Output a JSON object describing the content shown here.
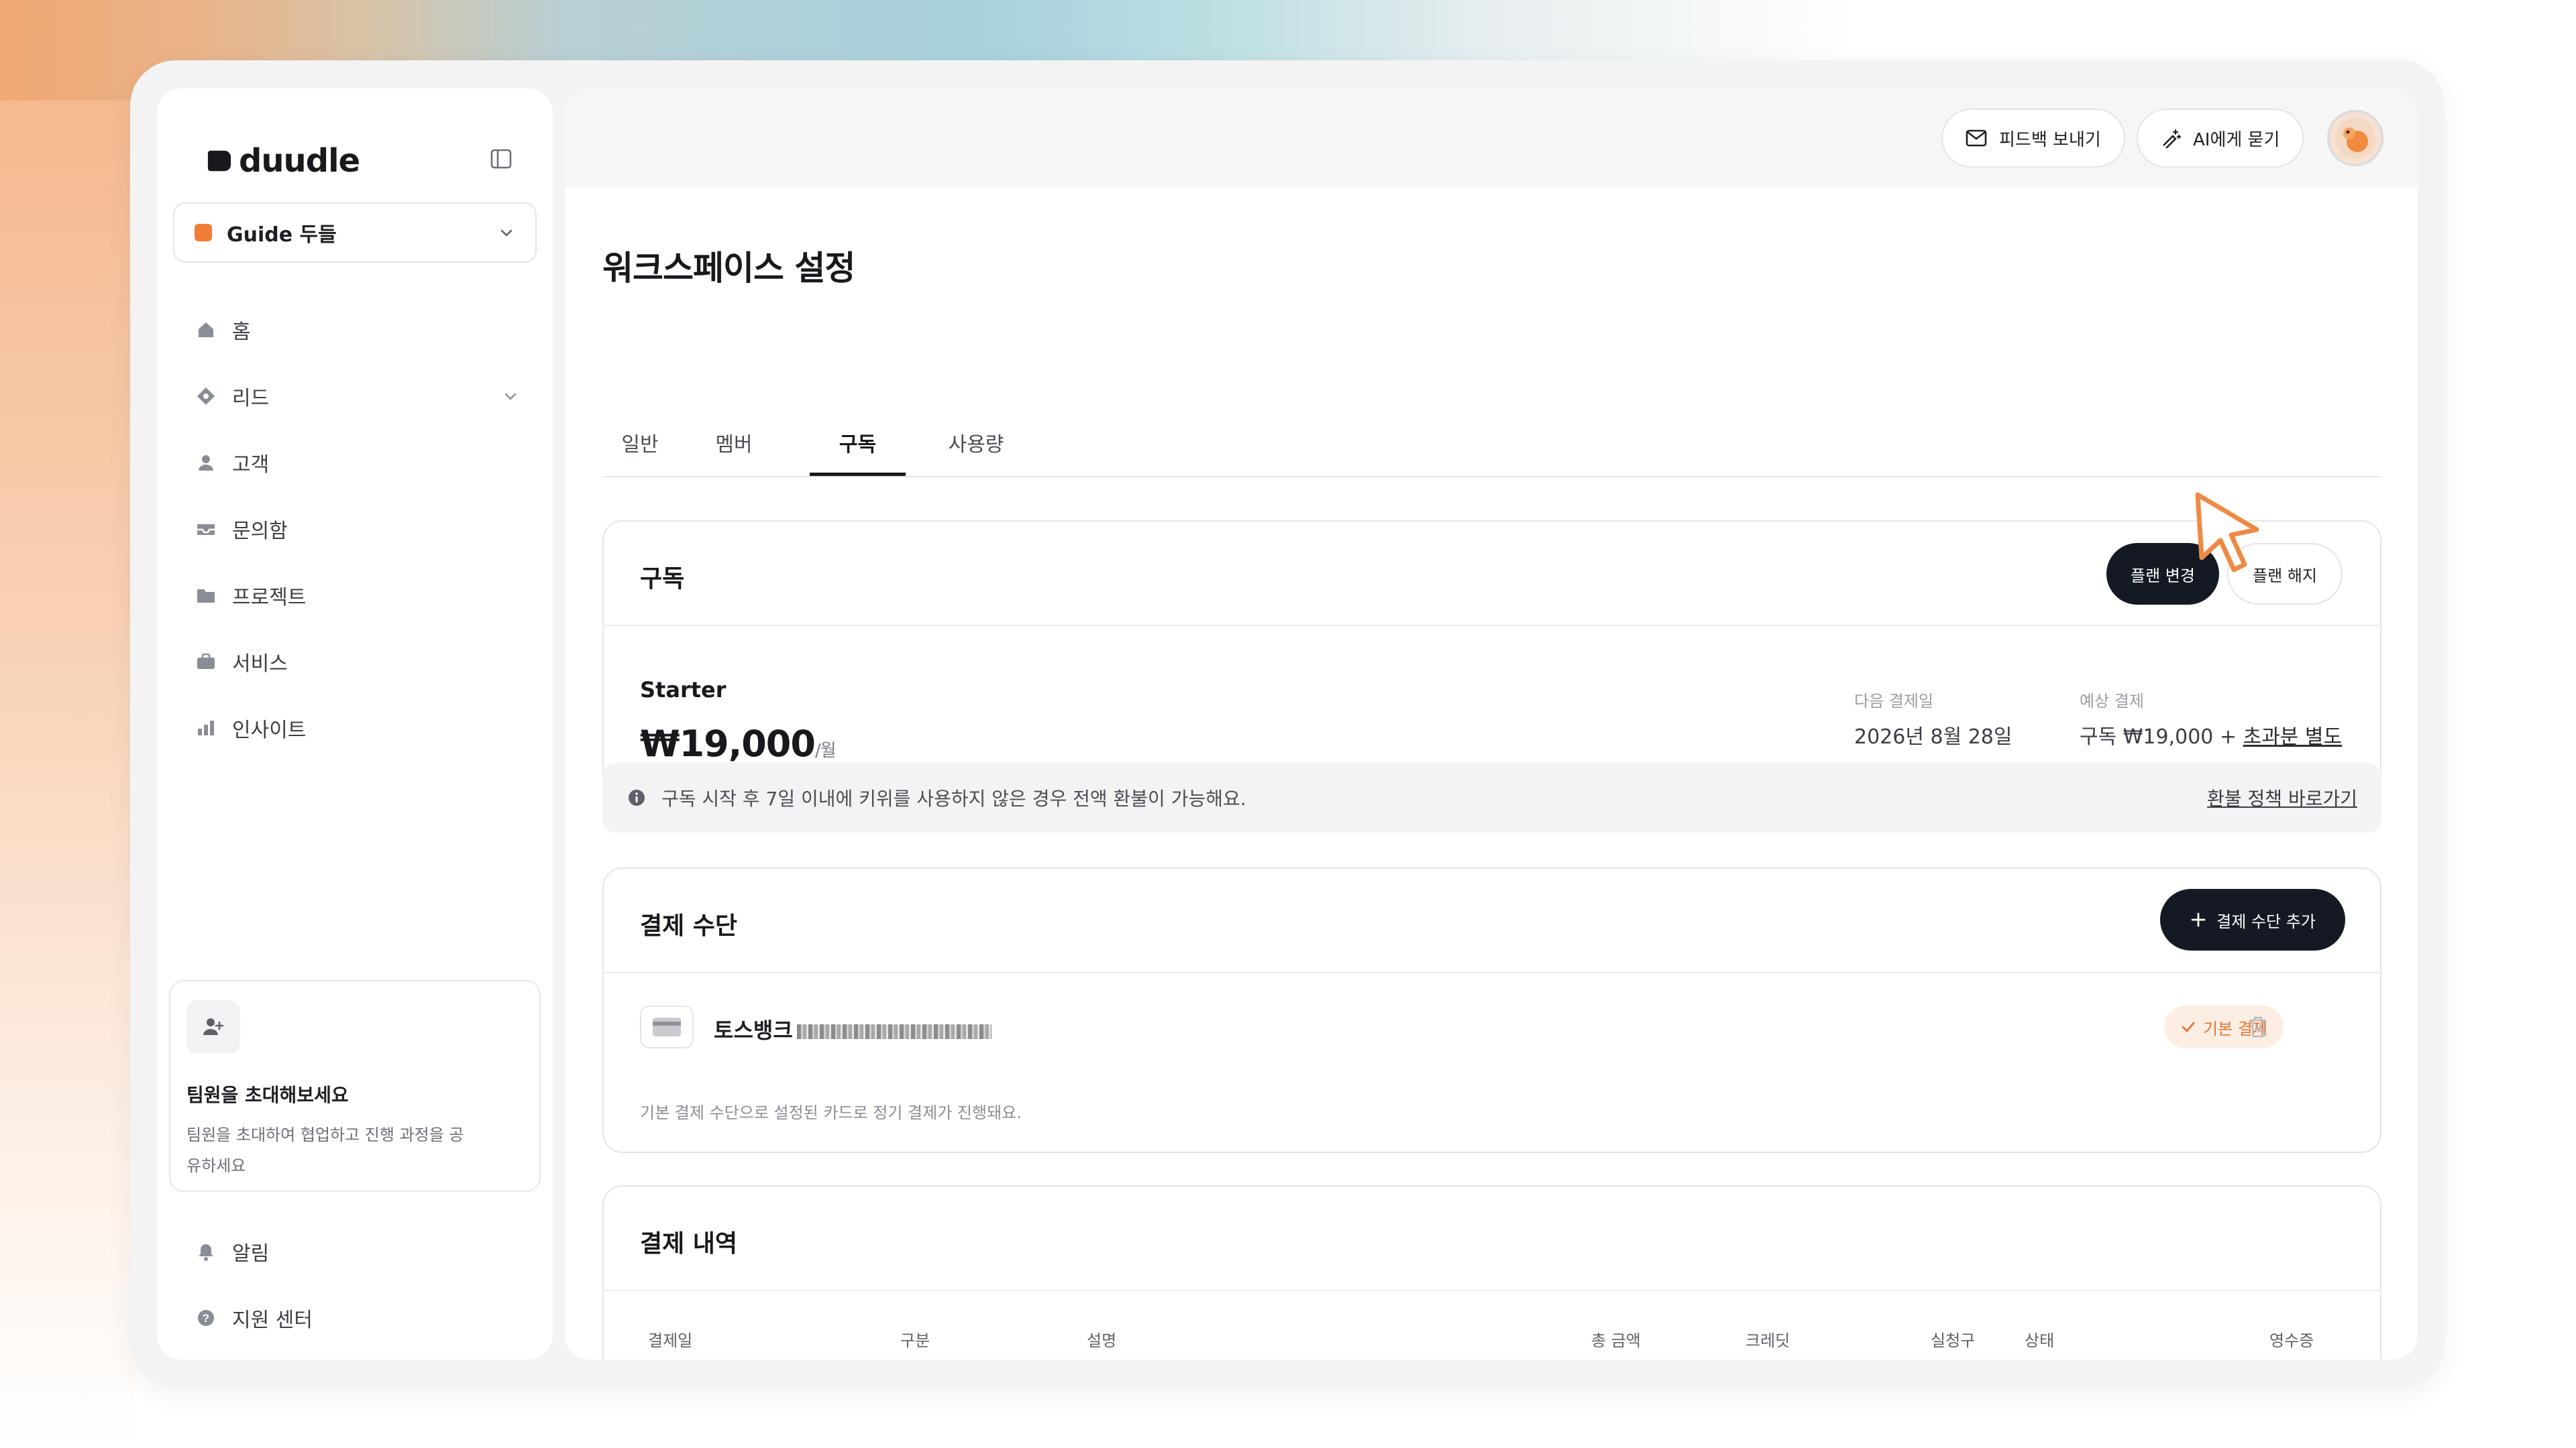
{
  "brand": {
    "name": "duudle"
  },
  "workspace": {
    "name": "Guide 두들"
  },
  "nav": {
    "items": [
      {
        "label": "홈",
        "icon": "home-icon"
      },
      {
        "label": "리드",
        "icon": "lead-icon"
      },
      {
        "label": "고객",
        "icon": "user-icon"
      },
      {
        "label": "문의함",
        "icon": "inbox-icon"
      },
      {
        "label": "프로젝트",
        "icon": "folder-icon"
      },
      {
        "label": "서비스",
        "icon": "briefcase-icon"
      },
      {
        "label": "인사이트",
        "icon": "chart-icon"
      }
    ],
    "bottom": [
      {
        "label": "알림",
        "icon": "bell-icon"
      },
      {
        "label": "지원 센터",
        "icon": "help-icon"
      }
    ]
  },
  "invite": {
    "title": "팀원을 초대해보세요",
    "description": "팀원을 초대하여 협업하고 진행 과정을 공유하세요"
  },
  "topbar": {
    "feedback_label": "피드백 보내기",
    "ask_ai_label": "AI에게 묻기"
  },
  "page": {
    "title": "워크스페이스 설정",
    "tabs": [
      "일반",
      "멤버",
      "구독",
      "사용량"
    ],
    "active_tab": "구독"
  },
  "subscription": {
    "title": "구독",
    "change_plan_label": "플랜 변경",
    "cancel_plan_label": "플랜 해지",
    "plan_name": "Starter",
    "price": "₩19,000",
    "price_unit": "/월",
    "next_billing_label": "다음 결제일",
    "next_billing_value": "2026년 8월 28일",
    "expected_label": "예상 결제",
    "expected_value_prefix": "구독 ₩19,000 + ",
    "expected_value_link": "초과분 별도"
  },
  "notice": {
    "text": "구독 시작 후 7일 이내에 키위를 사용하지 않은 경우 전액 환불이 가능해요.",
    "link": "환불 정책 바로가기"
  },
  "payment_method": {
    "title": "결제 수단",
    "add_label": "결제 수단 추가",
    "bank_name": "토스뱅크",
    "default_badge": "기본 결제",
    "note": "기본 결제 수단으로 설정된 카드로 정기 결제가 진행돼요."
  },
  "history": {
    "title": "결제 내역",
    "columns": [
      "결제일",
      "구분",
      "설명",
      "총 금액",
      "크레딧",
      "실청구",
      "상태",
      "영수증"
    ]
  },
  "colors": {
    "accent": "#f27b35",
    "dark_button": "#141923",
    "badge_bg": "#fdeee3"
  }
}
